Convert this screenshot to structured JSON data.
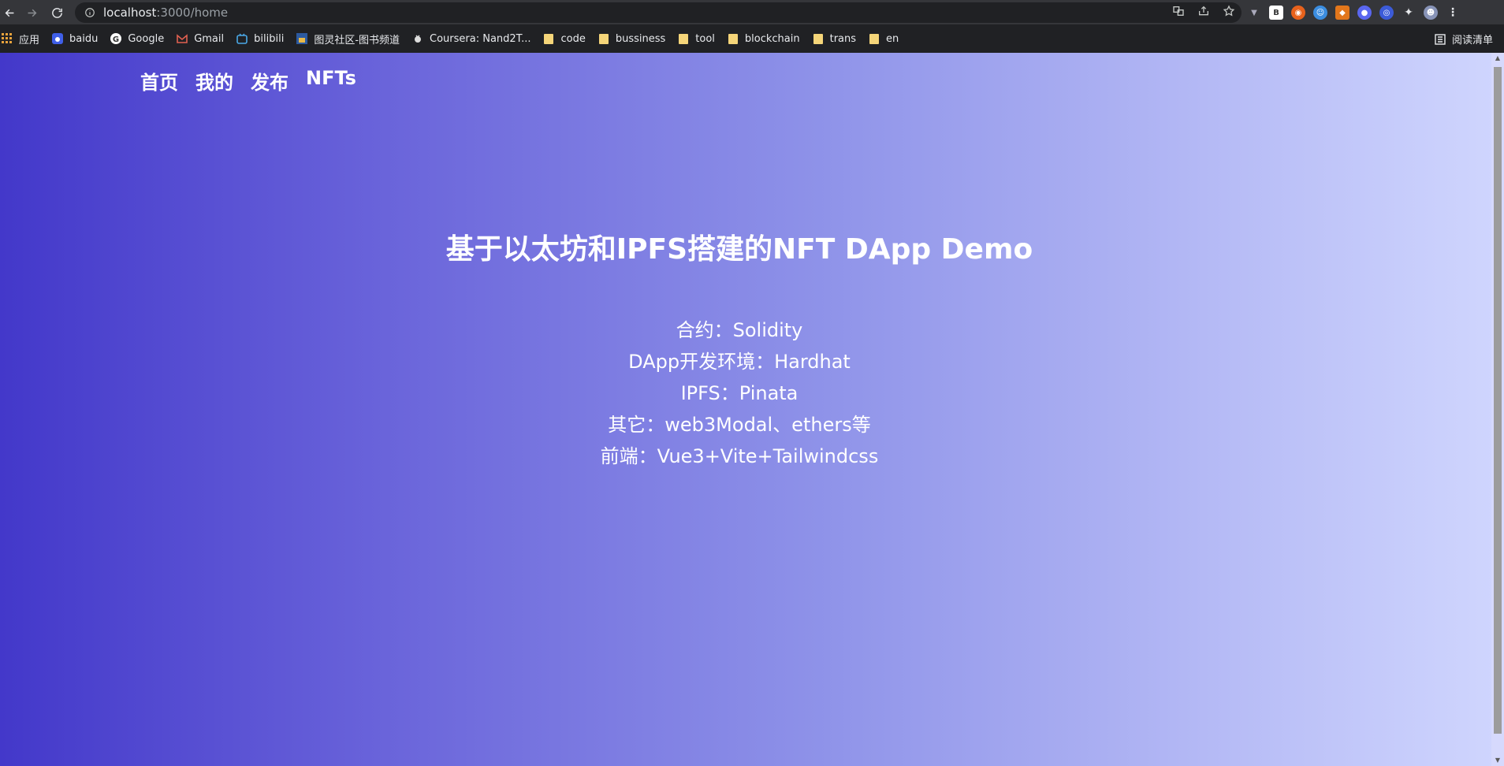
{
  "browser": {
    "url_host": "localhost",
    "url_path": ":3000/home",
    "bookmarks": [
      {
        "label": "应用",
        "icon": "apps-grid-icon"
      },
      {
        "label": "baidu",
        "icon": "baidu-icon"
      },
      {
        "label": "Google",
        "icon": "google-icon"
      },
      {
        "label": "Gmail",
        "icon": "gmail-icon"
      },
      {
        "label": "bilibili",
        "icon": "bilibili-icon"
      },
      {
        "label": "图灵社区-图书频道",
        "icon": "turing-icon"
      },
      {
        "label": "Coursera: Nand2T...",
        "icon": "coursera-icon"
      },
      {
        "label": "code",
        "icon": "folder-icon"
      },
      {
        "label": "bussiness",
        "icon": "folder-icon"
      },
      {
        "label": "tool",
        "icon": "folder-icon"
      },
      {
        "label": "blockchain",
        "icon": "folder-icon"
      },
      {
        "label": "trans",
        "icon": "folder-icon"
      },
      {
        "label": "en",
        "icon": "folder-icon"
      }
    ],
    "reading_list": "阅读清单"
  },
  "site": {
    "nav": [
      "首页",
      "我的",
      "发布",
      "NFTs"
    ],
    "title": "基于以太坊和IPFS搭建的NFT DApp Demo",
    "stack": [
      "合约：Solidity",
      "DApp开发环境：Hardhat",
      "IPFS：Pinata",
      "其它：web3Modal、ethers等",
      "前端：Vue3+Vite+Tailwindcss"
    ]
  },
  "colors": {
    "gradient_start": "#4338ca",
    "gradient_end": "#d0d6fe",
    "text": "#ffffff",
    "chrome_bg": "#202124"
  }
}
